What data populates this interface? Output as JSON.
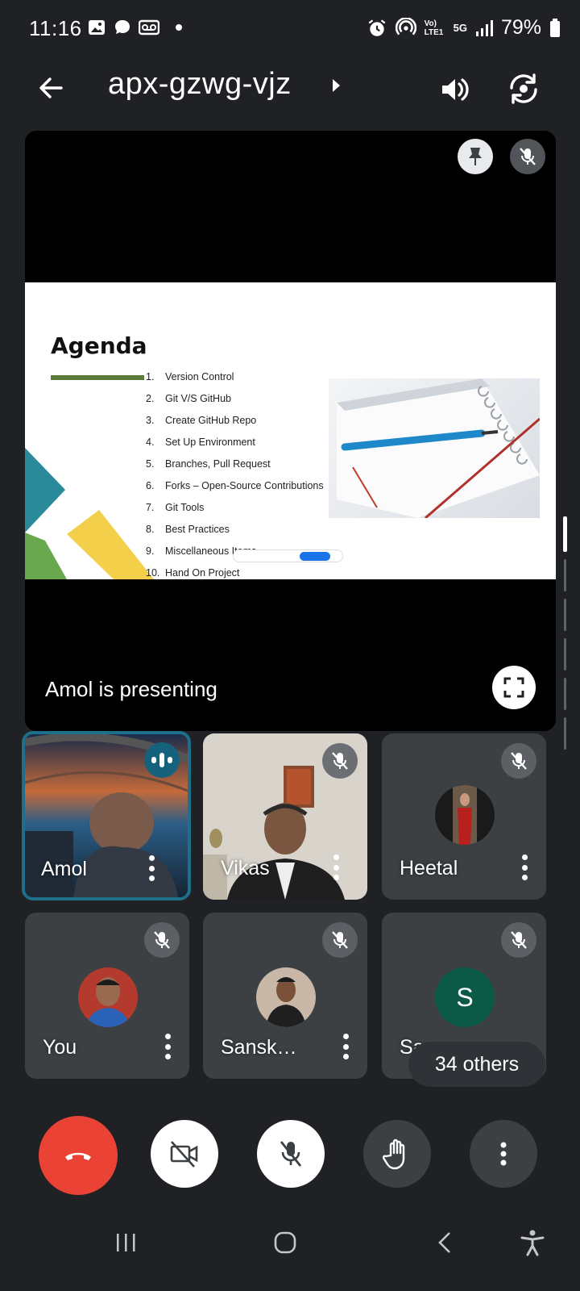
{
  "status_bar": {
    "time": "11:16",
    "battery": "79%",
    "left_icons": [
      "gallery-icon",
      "chat-bubble-icon",
      "voicemail-icon",
      "dot-icon"
    ],
    "right_icons": [
      "alarm-icon",
      "hotspot-icon",
      "volte-icon",
      "5g-icon",
      "signal-icon",
      "battery-icon"
    ],
    "network_label": "Vo) LTE1",
    "five_g": "5G"
  },
  "header": {
    "meeting_code": "apx-gzwg-vjz"
  },
  "presentation": {
    "slide": {
      "title": "Agenda",
      "items": [
        {
          "num": "1.",
          "text": "Version Control"
        },
        {
          "num": "2.",
          "text": "Git V/S GitHub"
        },
        {
          "num": "3.",
          "text": "Create GitHub Repo"
        },
        {
          "num": "4.",
          "text": "Set Up Environment"
        },
        {
          "num": "5.",
          "text": "Branches, Pull Request"
        },
        {
          "num": "6.",
          "text": "Forks – Open-Source Contributions"
        },
        {
          "num": "7.",
          "text": "Git Tools"
        },
        {
          "num": "8.",
          "text": "Best Practices"
        },
        {
          "num": "9.",
          "text": "Miscellaneous Items"
        },
        {
          "num": "10.",
          "text": "Hand On Project"
        }
      ],
      "accent_colors": [
        "#2a8a9a",
        "#f4d04a",
        "#6aa84f",
        "#5a7b3c"
      ]
    },
    "presenting_text": "Amol is presenting"
  },
  "participants": [
    {
      "name": "Amol",
      "speaking": true,
      "muted": false
    },
    {
      "name": "Vikas",
      "speaking": false,
      "muted": true
    },
    {
      "name": "Heetal",
      "speaking": false,
      "muted": true
    },
    {
      "name": "You",
      "speaking": false,
      "muted": true
    },
    {
      "name": "Sansk…",
      "speaking": false,
      "muted": true
    },
    {
      "name": "Sa",
      "avatar_initial": "S",
      "speaking": false,
      "muted": true
    }
  ],
  "others_pill": "34 others",
  "colors": {
    "background": "#202124",
    "tile": "#3c4043",
    "end_call": "#ea4335",
    "active_border": "#1e6f8a",
    "avatar_s": "#0b5a47"
  }
}
